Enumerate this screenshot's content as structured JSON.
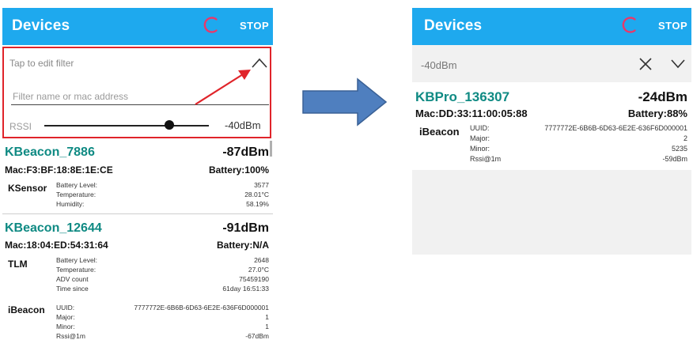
{
  "left_screen": {
    "appbar": {
      "title": "Devices",
      "stop_label": "STOP"
    },
    "filter": {
      "hint": "Tap to edit filter",
      "placeholder": "Filter name or mac address",
      "value": "",
      "rssi_label": "RSSI",
      "rssi_value": "-40dBm",
      "slider_fraction": 0.76
    },
    "devices": [
      {
        "name": "KBeacon_7886",
        "rssi": "-87dBm",
        "mac": "Mac:F3:BF:18:8E:1E:CE",
        "battery": "Battery:100%",
        "frames": [
          {
            "type": "KSensor",
            "rows": [
              {
                "label": "Battery Level:",
                "value": "3577"
              },
              {
                "label": "Temperature:",
                "value": "28.01°C"
              },
              {
                "label": "Humidity:",
                "value": "58.19%"
              }
            ]
          }
        ]
      },
      {
        "name": "KBeacon_12644",
        "rssi": "-91dBm",
        "mac": "Mac:18:04:ED:54:31:64",
        "battery": "Battery:N/A",
        "frames": [
          {
            "type": "TLM",
            "rows": [
              {
                "label": "Battery Level:",
                "value": "2648"
              },
              {
                "label": "Temperature:",
                "value": "27.0°C"
              },
              {
                "label": "ADV count",
                "value": "75459190"
              },
              {
                "label": "Time since",
                "value": "61day 16:51:33"
              }
            ]
          },
          {
            "type": "iBeacon",
            "rows": [
              {
                "label": "UUID:",
                "value": "7777772E-6B6B-6D63-6E2E-636F6D000001"
              },
              {
                "label": "Major:",
                "value": "1"
              },
              {
                "label": "Minor:",
                "value": "1"
              },
              {
                "label": "Rssi@1m",
                "value": "-67dBm"
              }
            ]
          }
        ]
      }
    ]
  },
  "right_screen": {
    "appbar": {
      "title": "Devices",
      "stop_label": "STOP"
    },
    "filter_bar": {
      "rssi_value": "-40dBm"
    },
    "device": {
      "name": "KBPro_136307",
      "rssi": "-24dBm",
      "mac": "Mac:DD:33:11:00:05:88",
      "battery": "Battery:88%",
      "frame": {
        "type": "iBeacon",
        "rows": [
          {
            "label": "UUID:",
            "value": "7777772E-6B6B-6D63-6E2E-636F6D000001"
          },
          {
            "label": "Major:",
            "value": "2"
          },
          {
            "label": "Minor:",
            "value": "5235"
          },
          {
            "label": "Rssi@1m",
            "value": "-59dBm"
          }
        ]
      }
    }
  },
  "colors": {
    "appbar": "#1ea9ee",
    "spinner": "#e9386a",
    "device_name": "#0f8a83",
    "highlight_border": "#e0242a",
    "annotation_arrow": "#e0242a",
    "transition_arrow": "#4f7fbf"
  },
  "icons": {
    "spinner": "loading-spinner-icon",
    "expand": "chevron-up-icon",
    "clear": "close-icon",
    "collapse": "chevron-down-icon"
  }
}
